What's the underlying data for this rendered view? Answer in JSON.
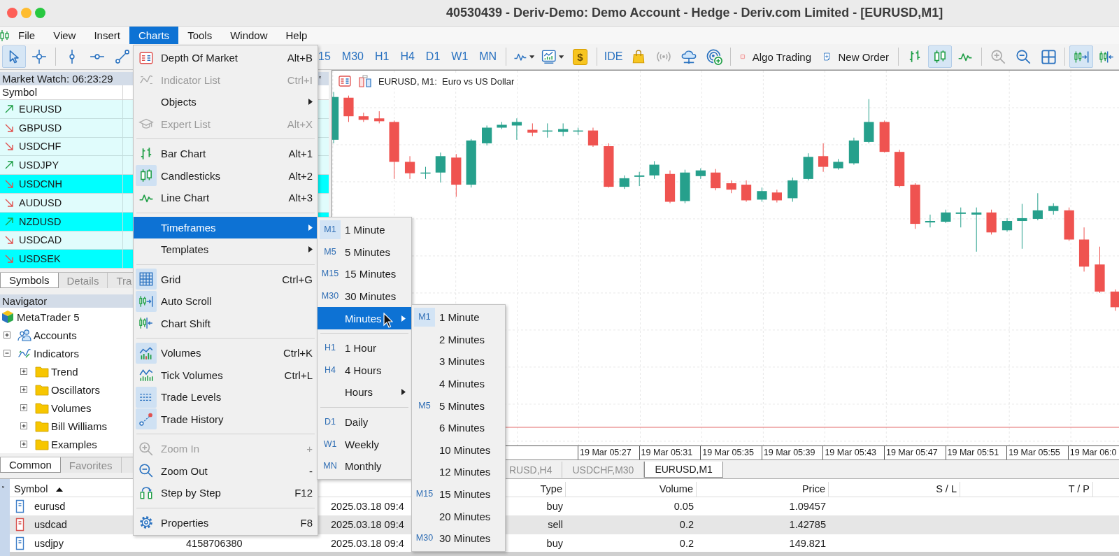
{
  "window": {
    "title": "40530439 - Deriv-Demo: Demo Account - Hedge - Deriv.com Limited - [EURUSD,M1]"
  },
  "menu_bar": [
    {
      "label": "File",
      "selected": false
    },
    {
      "label": "View",
      "selected": false
    },
    {
      "label": "Insert",
      "selected": false
    },
    {
      "label": "Charts",
      "selected": true
    },
    {
      "label": "Tools",
      "selected": false
    },
    {
      "label": "Window",
      "selected": false
    },
    {
      "label": "Help",
      "selected": false
    }
  ],
  "toolbar": {
    "drawing_tools": [
      {
        "selected": true
      },
      {
        "selected": false
      },
      {
        "selected": false
      },
      {
        "selected": false
      },
      {
        "selected": false
      }
    ],
    "timeframes": [
      {
        "label": "15",
        "selected": false
      },
      {
        "label": "M30",
        "selected": false
      },
      {
        "label": "H1",
        "selected": false
      },
      {
        "label": "H4",
        "selected": false
      },
      {
        "label": "D1",
        "selected": false
      },
      {
        "label": "W1",
        "selected": false
      },
      {
        "label": "MN",
        "selected": false
      }
    ],
    "market_button": "$",
    "ide_button": "IDE",
    "signals_button": {
      "disabled": true
    },
    "algo_trading": {
      "label": "Algo Trading",
      "on": false
    },
    "new_order_button": "New Order",
    "chart_types": [
      {
        "selected": false
      },
      {
        "selected": true
      },
      {
        "selected": false
      }
    ],
    "zoom_buttons": [
      {
        "disabled": true
      },
      {
        "disabled": false
      }
    ],
    "scroll_buttons": [
      {
        "selected": true
      },
      {
        "selected": false
      }
    ]
  },
  "market_watch": {
    "title": "Market Watch: 06:23:29",
    "column": "Symbol",
    "rows": [
      {
        "symbol": "EURUSD",
        "rising": true,
        "highlighted": false
      },
      {
        "symbol": "GBPUSD",
        "rising": false,
        "highlighted": false
      },
      {
        "symbol": "USDCHF",
        "rising": false,
        "highlighted": false
      },
      {
        "symbol": "USDJPY",
        "rising": true,
        "highlighted": false
      },
      {
        "symbol": "USDCNH",
        "rising": false,
        "highlighted": true
      },
      {
        "symbol": "AUDUSD",
        "rising": false,
        "highlighted": false
      },
      {
        "symbol": "NZDUSD",
        "rising": true,
        "highlighted": true
      },
      {
        "symbol": "USDCAD",
        "rising": false,
        "highlighted": false
      },
      {
        "symbol": "USDSEK",
        "rising": false,
        "highlighted": true
      }
    ],
    "tabs": [
      {
        "label": "Symbols",
        "selected": true
      },
      {
        "label": "Details",
        "selected": false
      },
      {
        "label": "Tra",
        "selected": false
      }
    ]
  },
  "navigator": {
    "title": "Navigator",
    "tree": {
      "label": "MetaTrader 5",
      "children": [
        {
          "label": "Accounts",
          "expanded": false
        },
        {
          "label": "Indicators",
          "expanded": true,
          "children": [
            {
              "label": "Trend",
              "expanded": false
            },
            {
              "label": "Oscillators",
              "expanded": false
            },
            {
              "label": "Volumes",
              "expanded": false
            },
            {
              "label": "Bill Williams",
              "expanded": false
            },
            {
              "label": "Examples",
              "expanded": false
            }
          ]
        }
      ]
    },
    "tabs": [
      {
        "label": "Common",
        "selected": true
      },
      {
        "label": "Favorites",
        "selected": false
      }
    ]
  },
  "chart": {
    "title": "EURUSD, M1:  Euro vs US Dollar",
    "time_labels": [
      "19 Mar 05:27",
      "19 Mar 05:31",
      "19 Mar 05:35",
      "19 Mar 05:39",
      "19 Mar 05:43",
      "19 Mar 05:47",
      "19 Mar 05:51",
      "19 Mar 05:55",
      "19 Mar 06:0"
    ],
    "tabs": [
      {
        "label": "RUSD,H4",
        "selected": false
      },
      {
        "label": "USDCHF,M30",
        "selected": false
      },
      {
        "label": "EURUSD,M1",
        "selected": true
      }
    ]
  },
  "toolbox": {
    "columns": {
      "symbol": "Symbol",
      "type": "Type",
      "volume": "Volume",
      "price": "Price",
      "sl": "S / L",
      "tp": "T / P"
    },
    "rows": [
      {
        "symbol": "eurusd",
        "time": "2025.03.18 09:4",
        "type": "buy",
        "volume": "0.05",
        "price": "1.09457",
        "color": "#3f7fc8",
        "selected": false
      },
      {
        "symbol": "usdcad",
        "time": "2025.03.18 09:4",
        "type": "sell",
        "volume": "0.2",
        "price": "1.42785",
        "color": "#d9534f",
        "selected": true
      },
      {
        "symbol": "usdjpy",
        "ticket": "4158706380",
        "time": "2025.03.18 09:4",
        "type": "buy",
        "volume": "0.2",
        "price": "149.821",
        "color": "#3f7fc8",
        "selected": false
      }
    ]
  },
  "charts_menu": [
    {
      "kind": "item",
      "label": "Depth Of Market",
      "shortcut": "Alt+B",
      "disabled": false,
      "checked": false,
      "submenu": false,
      "selected": false
    },
    {
      "kind": "item",
      "label": "Indicator List",
      "shortcut": "Ctrl+I",
      "disabled": true,
      "checked": false,
      "submenu": false,
      "selected": false
    },
    {
      "kind": "item",
      "label": "Objects",
      "disabled": false,
      "checked": false,
      "submenu": true,
      "selected": false
    },
    {
      "kind": "item",
      "label": "Expert List",
      "shortcut": "Alt+X",
      "disabled": true,
      "checked": false,
      "submenu": false,
      "selected": false
    },
    {
      "kind": "separator"
    },
    {
      "kind": "item",
      "label": "Bar Chart",
      "shortcut": "Alt+1",
      "disabled": false,
      "checked": false,
      "submenu": false,
      "selected": false
    },
    {
      "kind": "item",
      "label": "Candlesticks",
      "shortcut": "Alt+2",
      "disabled": false,
      "checked": true,
      "submenu": false,
      "selected": false
    },
    {
      "kind": "item",
      "label": "Line Chart",
      "shortcut": "Alt+3",
      "disabled": false,
      "checked": false,
      "submenu": false,
      "selected": false
    },
    {
      "kind": "separator"
    },
    {
      "kind": "item",
      "label": "Timeframes",
      "disabled": false,
      "checked": false,
      "submenu": true,
      "selected": true
    },
    {
      "kind": "item",
      "label": "Templates",
      "disabled": false,
      "checked": false,
      "submenu": true,
      "selected": false
    },
    {
      "kind": "separator"
    },
    {
      "kind": "item",
      "label": "Grid",
      "shortcut": "Ctrl+G",
      "disabled": false,
      "checked": true,
      "submenu": false,
      "selected": false
    },
    {
      "kind": "item",
      "label": "Auto Scroll",
      "disabled": false,
      "checked": true,
      "submenu": false,
      "selected": false
    },
    {
      "kind": "item",
      "label": "Chart Shift",
      "disabled": false,
      "checked": false,
      "submenu": false,
      "selected": false
    },
    {
      "kind": "separator"
    },
    {
      "kind": "item",
      "label": "Volumes",
      "shortcut": "Ctrl+K",
      "disabled": false,
      "checked": true,
      "submenu": false,
      "selected": false
    },
    {
      "kind": "item",
      "label": "Tick Volumes",
      "shortcut": "Ctrl+L",
      "disabled": false,
      "checked": false,
      "submenu": false,
      "selected": false
    },
    {
      "kind": "item",
      "label": "Trade Levels",
      "disabled": false,
      "checked": true,
      "submenu": false,
      "selected": false
    },
    {
      "kind": "item",
      "label": "Trade History",
      "disabled": false,
      "checked": true,
      "submenu": false,
      "selected": false
    },
    {
      "kind": "separator"
    },
    {
      "kind": "item",
      "label": "Zoom In",
      "shortcut": "+",
      "disabled": true,
      "checked": false,
      "submenu": false,
      "selected": false
    },
    {
      "kind": "item",
      "label": "Zoom Out",
      "shortcut": "-",
      "disabled": false,
      "checked": false,
      "submenu": false,
      "selected": false
    },
    {
      "kind": "item",
      "label": "Step by Step",
      "shortcut": "F12",
      "disabled": false,
      "checked": false,
      "submenu": false,
      "selected": false
    },
    {
      "kind": "separator"
    },
    {
      "kind": "item",
      "label": "Properties",
      "shortcut": "F8",
      "disabled": false,
      "checked": false,
      "submenu": false,
      "selected": false
    }
  ],
  "timeframes_menu": [
    {
      "kind": "item",
      "badge": "M1",
      "label": "1 Minute",
      "checked": true,
      "submenu": false,
      "selected": false
    },
    {
      "kind": "item",
      "badge": "M5",
      "label": "5 Minutes",
      "checked": false,
      "submenu": false,
      "selected": false
    },
    {
      "kind": "item",
      "badge": "M15",
      "label": "15 Minutes",
      "checked": false,
      "submenu": false,
      "selected": false
    },
    {
      "kind": "item",
      "badge": "M30",
      "label": "30 Minutes",
      "checked": false,
      "submenu": false,
      "selected": false
    },
    {
      "kind": "item",
      "label": "Minutes",
      "checked": false,
      "submenu": true,
      "selected": true
    },
    {
      "kind": "separator"
    },
    {
      "kind": "item",
      "badge": "H1",
      "label": "1 Hour",
      "checked": false,
      "submenu": false,
      "selected": false
    },
    {
      "kind": "item",
      "badge": "H4",
      "label": "4 Hours",
      "checked": false,
      "submenu": false,
      "selected": false
    },
    {
      "kind": "item",
      "label": "Hours",
      "checked": false,
      "submenu": true,
      "selected": false
    },
    {
      "kind": "separator"
    },
    {
      "kind": "item",
      "badge": "D1",
      "label": "Daily",
      "checked": false,
      "submenu": false,
      "selected": false
    },
    {
      "kind": "item",
      "badge": "W1",
      "label": "Weekly",
      "checked": false,
      "submenu": false,
      "selected": false
    },
    {
      "kind": "item",
      "badge": "MN",
      "label": "Monthly",
      "checked": false,
      "submenu": false,
      "selected": false
    }
  ],
  "minutes_menu": [
    {
      "badge": "M1",
      "label": "1 Minute",
      "checked": true,
      "submenu": false,
      "selected": false
    },
    {
      "label": "2 Minutes",
      "checked": false,
      "submenu": false,
      "selected": false
    },
    {
      "label": "3 Minutes",
      "checked": false,
      "submenu": false,
      "selected": false
    },
    {
      "label": "4 Minutes",
      "checked": false,
      "submenu": false,
      "selected": false
    },
    {
      "badge": "M5",
      "label": "5 Minutes",
      "checked": false,
      "submenu": false,
      "selected": false
    },
    {
      "label": "6 Minutes",
      "checked": false,
      "submenu": false,
      "selected": false
    },
    {
      "label": "10 Minutes",
      "checked": false,
      "submenu": false,
      "selected": false
    },
    {
      "label": "12 Minutes",
      "checked": false,
      "submenu": false,
      "selected": false
    },
    {
      "badge": "M15",
      "label": "15 Minutes",
      "checked": false,
      "submenu": false,
      "selected": false
    },
    {
      "label": "20 Minutes",
      "checked": false,
      "submenu": false,
      "selected": false
    },
    {
      "badge": "M30",
      "label": "30 Minutes",
      "checked": false,
      "submenu": false,
      "selected": false
    }
  ]
}
